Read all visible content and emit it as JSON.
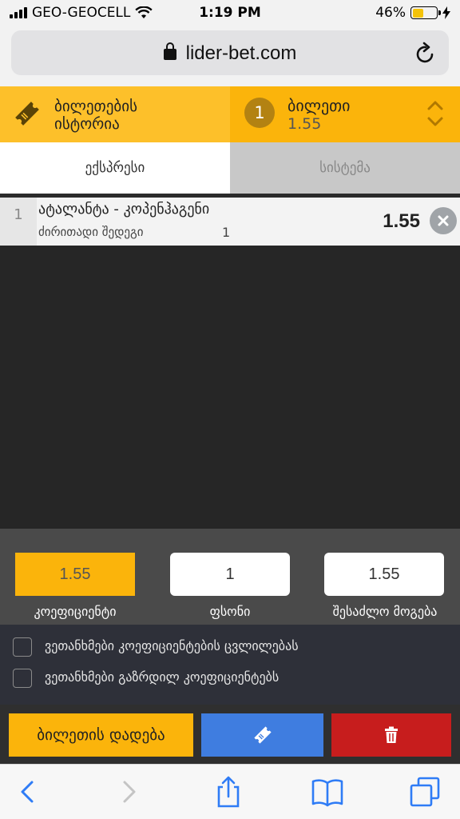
{
  "status_bar": {
    "carrier": "GEO-GEOCELL",
    "time": "1:19 PM",
    "battery": "46%",
    "battery_level": 0.46
  },
  "browser": {
    "url": "lider-bet.com"
  },
  "header": {
    "history_label_line1": "ბილეთების",
    "history_label_line2": "ისტორია",
    "slip_count": "1",
    "slip_title": "ბილეთი",
    "slip_odds": "1.55"
  },
  "tabs": {
    "express": "ექსპრესი",
    "system": "სისტემა"
  },
  "bet": {
    "index": "1",
    "match": "ატალანტა - კოპენჰაგენი",
    "market": "ძირითადი შედეგი",
    "outcome": "1",
    "odds": "1.55"
  },
  "stake_panel": {
    "coefficient_value": "1.55",
    "stake_value": "1",
    "possible_win_value": "1.55",
    "coefficient_label": "კოეფიციენტი",
    "stake_label": "ფსონი",
    "possible_win_label": "შესაძლო მოგება"
  },
  "options": {
    "accept_changes": "ვეთანხმები კოეფიციენტების ცვლილებას",
    "accept_increase": "ვეთანხმები გაზრდილ კოეფიციენტებს"
  },
  "actions": {
    "place_bet": "ბილეთის დადება"
  },
  "colors": {
    "accent": "#fbb40b",
    "share": "#3f7de0",
    "delete": "#c71d1d"
  }
}
